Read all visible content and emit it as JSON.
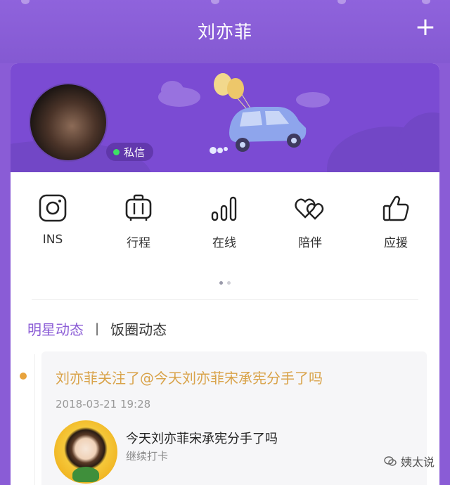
{
  "header": {
    "title": "刘亦菲",
    "add_label": "+"
  },
  "banner": {
    "message_label": "私信"
  },
  "quick_actions": [
    {
      "label": "INS",
      "icon": "instagram-icon"
    },
    {
      "label": "行程",
      "icon": "luggage-icon"
    },
    {
      "label": "在线",
      "icon": "signal-bars-icon"
    },
    {
      "label": "陪伴",
      "icon": "hearts-icon"
    },
    {
      "label": "应援",
      "icon": "thumbs-up-icon"
    }
  ],
  "pager": {
    "pages": 2,
    "active": 1
  },
  "tabs": {
    "active": "明星动态",
    "separator": "|",
    "other": "饭圈动态"
  },
  "feed": [
    {
      "headline": "刘亦菲关注了@今天刘亦菲宋承宪分手了吗",
      "time": "2018-03-21 19:28",
      "account_name": "今天刘亦菲宋承宪分手了吗",
      "account_desc": "继续打卡"
    }
  ],
  "watermark": {
    "text": "姨太说"
  },
  "colors": {
    "primary": "#8b5cd6",
    "accent": "#d9a34a",
    "online": "#3de064"
  }
}
